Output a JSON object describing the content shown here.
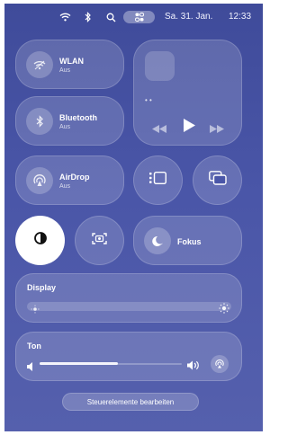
{
  "menubar": {
    "date": "Sa. 31. Jan.",
    "time": "12:33",
    "icons": [
      "wifi-icon",
      "bluetooth-icon",
      "search-icon",
      "control-center-icon"
    ]
  },
  "connectivity": {
    "wlan": {
      "title": "WLAN",
      "status": "Aus"
    },
    "bluetooth": {
      "title": "Bluetooth",
      "status": "Aus"
    },
    "airdrop": {
      "title": "AirDrop",
      "status": "Aus"
    }
  },
  "media": {
    "track_placeholder": "• •"
  },
  "focus": {
    "label": "Fokus"
  },
  "display": {
    "label": "Display",
    "brightness": 0
  },
  "sound": {
    "label": "Ton",
    "volume": 0.55
  },
  "footer": {
    "edit_label": "Steuerelemente bearbeiten"
  },
  "colors": {
    "background": "#4550a2",
    "accent": "#f4f4fb"
  }
}
